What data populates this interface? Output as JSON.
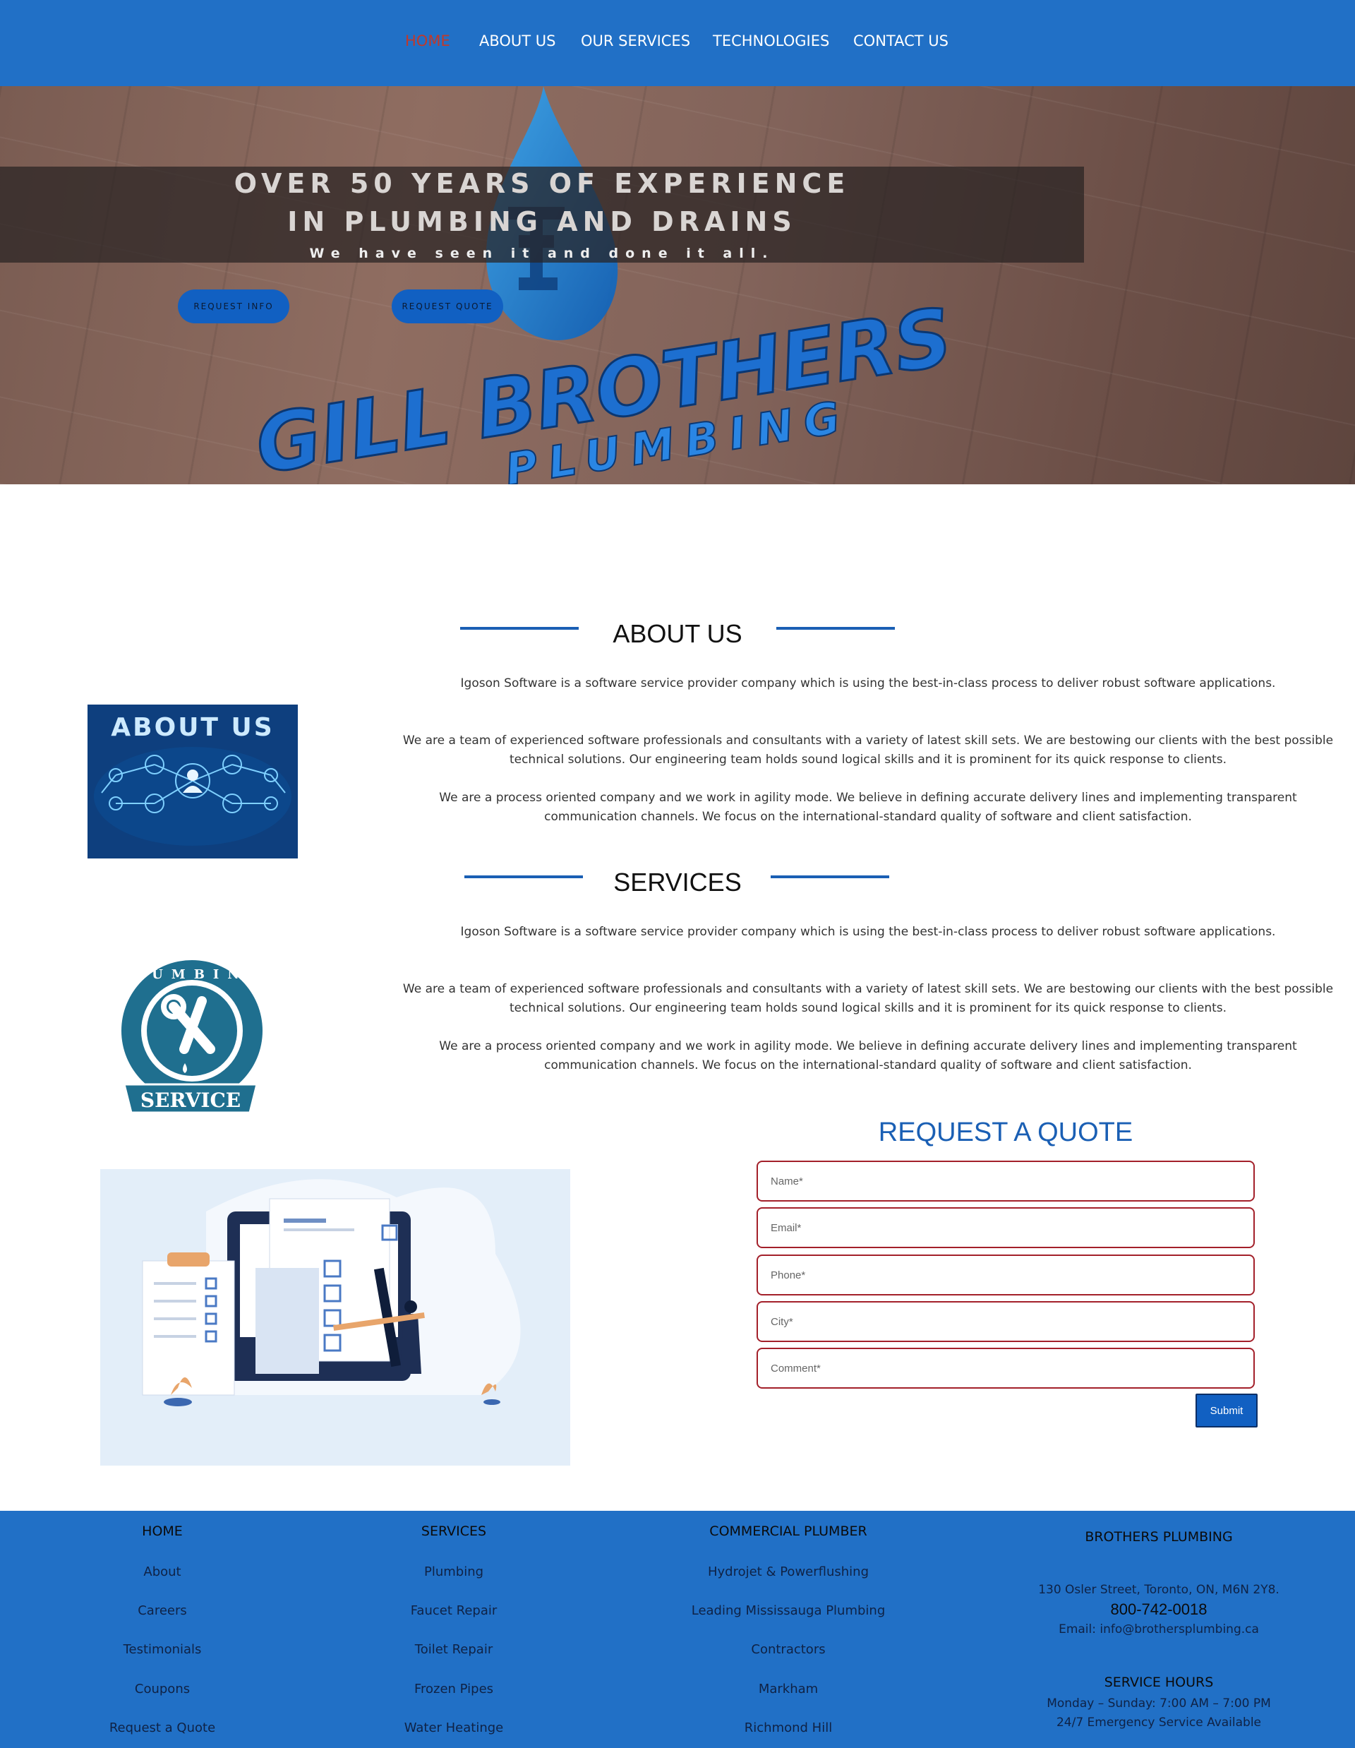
{
  "nav": {
    "items": [
      {
        "label": "HOME",
        "active": true
      },
      {
        "label": "ABOUT US",
        "active": false
      },
      {
        "label": "OUR SERVICES",
        "active": false
      },
      {
        "label": "TECHNOLOGIES",
        "active": false
      },
      {
        "label": "CONTACT US",
        "active": false
      }
    ],
    "active_color": "#c0392b"
  },
  "hero": {
    "line1": "OVER 50 YEARS OF EXPERIENCE",
    "line2": "IN PLUMBING AND DRAINS",
    "subline": "We have seen it and done it all.",
    "btn_info": "REQUEST INFO",
    "btn_quote": "REQUEST QUOTE",
    "logo_word1": "GILL BROTHERS",
    "logo_word2": "PLUMBING"
  },
  "about": {
    "title": "ABOUT US",
    "image_caption": "ABOUT US",
    "p1": "Igoson Software is a software service provider company which is using the best-in-class process to deliver robust software applications.",
    "p2": "We are a team of experienced software professionals and consultants with a variety of latest skill sets. We are bestowing our clients with the best possible technical solutions. Our engineering team holds sound logical skills and it is prominent for its quick response to clients.",
    "p3": "We are a process oriented company and we work in agility mode. We believe in defining accurate delivery lines and implementing transparent communication channels. We focus on the international-standard quality of software and client satisfaction."
  },
  "services": {
    "title": "SERVICES",
    "badge_top": "PLUMBING",
    "badge_bottom": "SERVICE",
    "p1": "Igoson Software is a software service provider company which is using the best-in-class process to deliver robust software applications.",
    "p2": "We are a team of experienced software professionals and consultants with a variety of latest skill sets. We are bestowing our clients with the best possible technical solutions. Our engineering team holds sound logical skills and it is prominent for its quick response to clients.",
    "p3": "We are a process oriented company and we work in agility mode. We believe in defining accurate delivery lines and implementing transparent communication channels. We focus on the international-standard quality of software and client satisfaction."
  },
  "quote": {
    "title": "REQUEST A QUOTE",
    "fields": [
      {
        "placeholder": "Name*",
        "value": ""
      },
      {
        "placeholder": "Email*",
        "value": ""
      },
      {
        "placeholder": "Phone*",
        "value": ""
      },
      {
        "placeholder": "City*",
        "value": ""
      },
      {
        "placeholder": "Comment*",
        "value": ""
      }
    ],
    "submit": "Submit"
  },
  "footer": {
    "col1": {
      "heading": "HOME",
      "links": [
        "About",
        "Careers",
        "Testimonials",
        "Coupons",
        "Request a Quote"
      ]
    },
    "col2": {
      "heading": "SERVICES",
      "links": [
        "Plumbing",
        "Faucet Repair",
        "Toilet Repair",
        "Frozen Pipes",
        "Water Heatinge"
      ]
    },
    "col3": {
      "heading": "COMMERCIAL PLUMBER",
      "links": [
        "Hydrojet & Powerflushing",
        "Leading Mississauga Plumbing",
        "Contractors",
        "Markham",
        "Richmond Hill"
      ]
    },
    "col4": {
      "heading": "BROTHERS PLUMBING",
      "address": "130 Osler Street, Toronto, ON, M6N 2Y8.",
      "phone": "800-742-0018",
      "email": "Email: info@brothersplumbing.ca",
      "hours_heading": "SERVICE HOURS",
      "hours_line1": "Monday – Sunday: 7:00 AM – 7:00 PM",
      "hours_line2": "24/7 Emergency Service Available"
    },
    "bg_color": "#2170c6"
  }
}
